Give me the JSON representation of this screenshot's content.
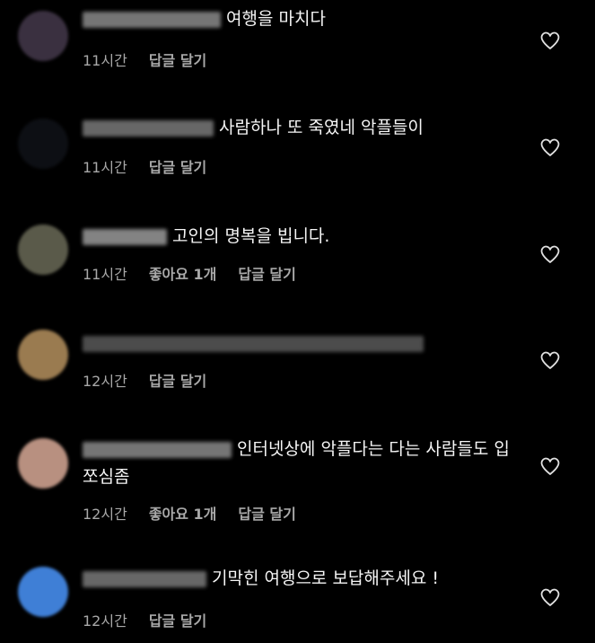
{
  "comments": [
    {
      "text": "여행을 마치다",
      "time": "11시간",
      "likes": "",
      "reply": "답글 달기",
      "avatar_color": "#3a3040",
      "username_color": "#8a8a8a"
    },
    {
      "text": "사람하나 또 죽였네 악플들이",
      "time": "11시간",
      "likes": "",
      "reply": "답글 달기",
      "avatar_color": "#0d0f14",
      "username_color": "#7a7a7a"
    },
    {
      "text": "고인의 명복을 빕니다.",
      "time": "11시간",
      "likes": "좋아요 1개",
      "reply": "답글 달기",
      "avatar_color": "#5a5a4a",
      "username_color": "#9a9a9a"
    },
    {
      "text": "",
      "time": "12시간",
      "likes": "",
      "reply": "답글 달기",
      "avatar_color": "#9a7b50",
      "username_color": "#5a5a5a"
    },
    {
      "text": "인터넷상에 악플다는 다는 사람들도  입쪼심좀",
      "time": "12시간",
      "likes": "좋아요 1개",
      "reply": "답글 달기",
      "avatar_color": "#b89080",
      "username_color": "#8a8a8a"
    },
    {
      "text": "기막힌 여행으로 보답해주세요 !",
      "time": "12시간",
      "likes": "",
      "reply": "답글 달기",
      "avatar_color": "#3f7fd6",
      "username_color": "#7a7a7a"
    }
  ],
  "icons": {
    "like": "heart-outline-icon"
  }
}
